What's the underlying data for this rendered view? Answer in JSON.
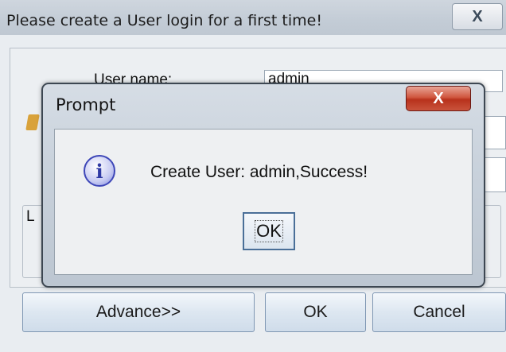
{
  "background_window": {
    "title": "Please create a User login for a first time!",
    "close_label": "X",
    "user_name_label": "User name:",
    "user_name_value": "admin",
    "group_label_fragment": "L",
    "buttons": {
      "advance": "Advance>>",
      "ok": "OK",
      "cancel": "Cancel"
    }
  },
  "prompt_dialog": {
    "title": "Prompt",
    "close_label": "X",
    "icon": "info-icon",
    "icon_glyph": "i",
    "message": "Create User: admin,Success!",
    "ok_label": "OK"
  },
  "colors": {
    "close_button_red": "#c9432c",
    "info_icon_blue": "#3e47b8",
    "button_border": "#7f97b3"
  }
}
